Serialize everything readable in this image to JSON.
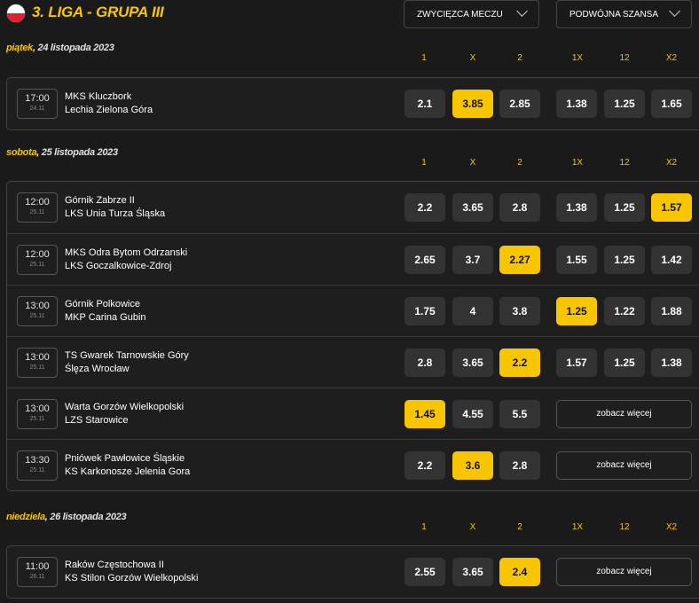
{
  "header": {
    "title": "3. LIGA - GRUPA III",
    "flag_icon": "poland-flag",
    "dropdown_winner": "ZWYCIĘZCA MECZU",
    "dropdown_double": "PODWÓJNA SZANSA"
  },
  "colors": {
    "accent": "#f7c600",
    "odd_bg": "#333333",
    "background": "#1a1a1a"
  },
  "columns": [
    "1",
    "X",
    "2",
    "1X",
    "12",
    "X2"
  ],
  "more_label": "zobacz więcej",
  "sections": [
    {
      "day": "piątek",
      "date": ", 24 listopada 2023",
      "matches": [
        {
          "time": "17:00",
          "date": "24.11",
          "home": "MKS Kluczbork",
          "away": "Lechia Zielona Góra",
          "odds": [
            "2.1",
            "3.85",
            "2.85"
          ],
          "double": [
            "1.38",
            "1.25",
            "1.65"
          ],
          "selected": [
            1
          ]
        }
      ]
    },
    {
      "day": "sobota",
      "date": ", 25 listopada 2023",
      "matches": [
        {
          "time": "12:00",
          "date": "25.11",
          "home": "Górnik Zabrze II",
          "away": "LKS Unia Turza Śląska",
          "odds": [
            "2.2",
            "3.65",
            "2.8"
          ],
          "double": [
            "1.38",
            "1.25",
            "1.57"
          ],
          "selected": [
            5
          ]
        },
        {
          "time": "12:00",
          "date": "25.11",
          "home": "MKS Odra Bytom Odrzanski",
          "away": "LKS Goczalkowice-Zdroj",
          "odds": [
            "2.65",
            "3.7",
            "2.27"
          ],
          "double": [
            "1.55",
            "1.25",
            "1.42"
          ],
          "selected": [
            2
          ]
        },
        {
          "time": "13:00",
          "date": "25.11",
          "home": "Górnik Polkowice",
          "away": "MKP Carina Gubin",
          "odds": [
            "1.75",
            "4",
            "3.8"
          ],
          "double": [
            "1.25",
            "1.22",
            "1.88"
          ],
          "selected": [
            3
          ]
        },
        {
          "time": "13:00",
          "date": "25.11",
          "home": "TS Gwarek Tarnowskie Góry",
          "away": "Ślęza Wrocław",
          "odds": [
            "2.8",
            "3.65",
            "2.2"
          ],
          "double": [
            "1.57",
            "1.25",
            "1.38"
          ],
          "selected": [
            2
          ]
        },
        {
          "time": "13:00",
          "date": "25.11",
          "home": "Warta Gorzów Wielkopolski",
          "away": "LZS Starowice",
          "odds": [
            "1.45",
            "4.55",
            "5.5"
          ],
          "double": null,
          "selected": [
            0
          ]
        },
        {
          "time": "13:30",
          "date": "25.11",
          "home": "Pniówek Pawłowice Śląskie",
          "away": "KS Karkonosze Jelenia Gora",
          "odds": [
            "2.2",
            "3.6",
            "2.8"
          ],
          "double": null,
          "selected": [
            1
          ]
        }
      ]
    },
    {
      "day": "niedziela",
      "date": ", 26 listopada 2023",
      "matches": [
        {
          "time": "11:00",
          "date": "26.11",
          "home": "Raków Częstochowa II",
          "away": "KS Stilon Gorzów Wielkopolski",
          "odds": [
            "2.55",
            "3.65",
            "2.4"
          ],
          "double": null,
          "selected": [
            2
          ]
        }
      ]
    }
  ]
}
